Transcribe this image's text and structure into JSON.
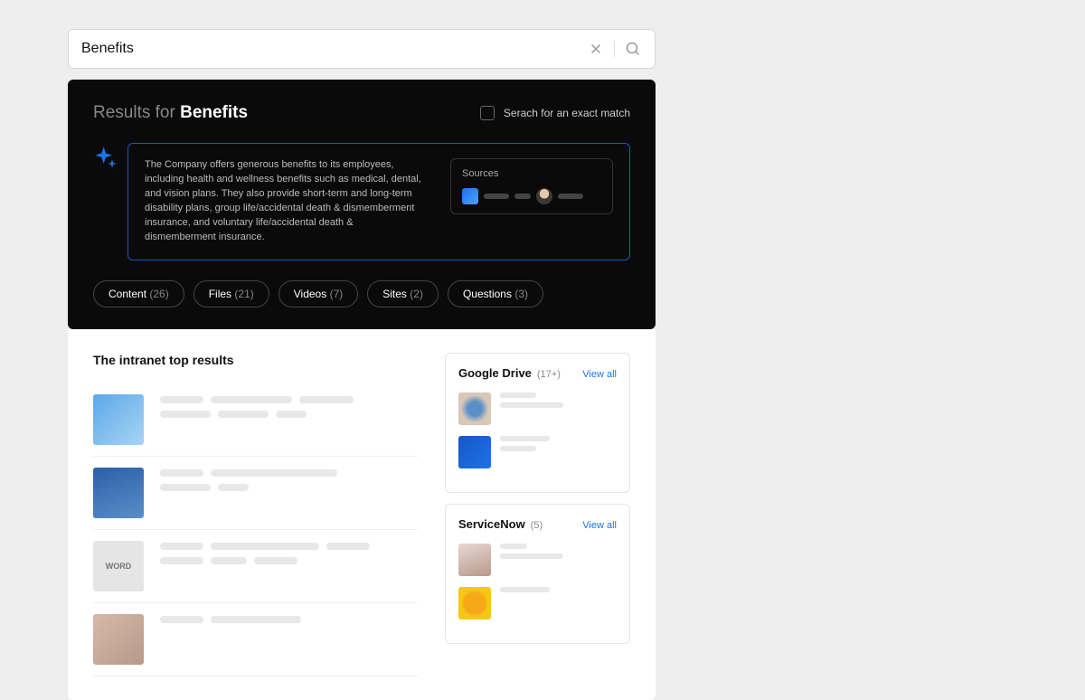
{
  "search": {
    "value": "Benefits"
  },
  "results": {
    "prefix": "Results for ",
    "term": "Benefits",
    "exact_match_label": "Serach for an exact match"
  },
  "ai": {
    "summary": "The Company offers generous benefits to its employees, including health and wellness benefits such as medical, dental, and vision plans. They also provide short-term and long-term disability plans, group life/accidental death & dismemberment insurance, and voluntary life/accidental death & dismemberment insurance.",
    "sources_label": "Sources"
  },
  "filters": [
    {
      "label": "Content",
      "count": "(26)"
    },
    {
      "label": "Files",
      "count": "(21)"
    },
    {
      "label": "Videos",
      "count": "(7)"
    },
    {
      "label": "Sites",
      "count": "(2)"
    },
    {
      "label": "Questions",
      "count": "(3)"
    }
  ],
  "intranet": {
    "title": "The intranet top results",
    "word_label": "WORD"
  },
  "side": {
    "gdrive": {
      "title": "Google Drive",
      "count": "(17+)",
      "view_all": "View all"
    },
    "snow": {
      "title": "ServiceNow",
      "count": "(5)",
      "view_all": "View all"
    }
  }
}
